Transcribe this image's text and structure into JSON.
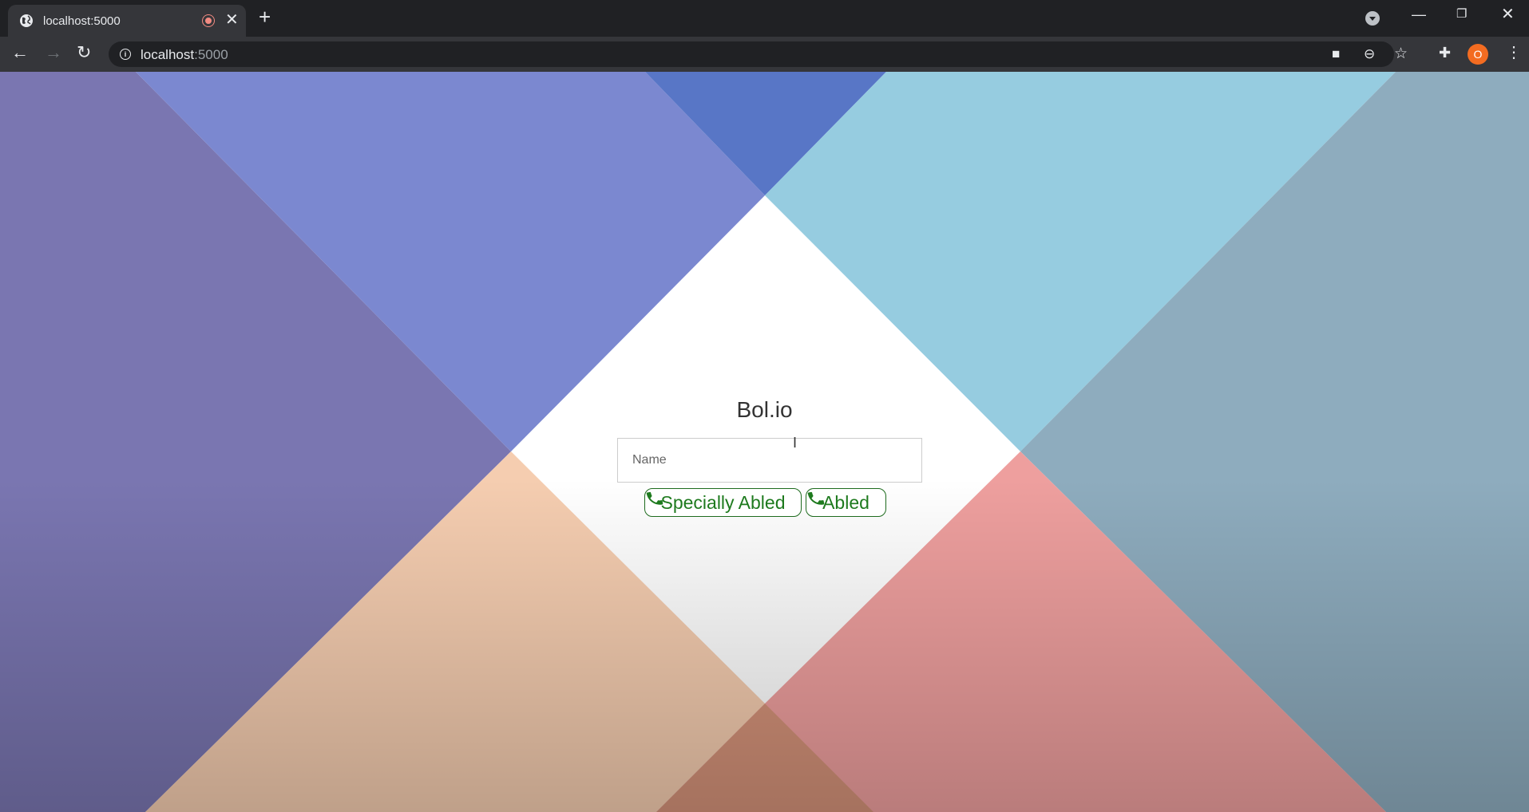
{
  "browser": {
    "tab_title": "localhost:5000",
    "url_host": "localhost",
    "url_port": ":5000",
    "profile_initial": "O",
    "icons": {
      "tab_favicon": "globe-icon",
      "recording": "recording-indicator-icon",
      "close": "close-icon",
      "new_tab": "plus-icon",
      "back": "back-arrow-icon",
      "forward": "forward-arrow-icon",
      "reload": "reload-icon",
      "site_info": "info-icon",
      "camera": "camera-icon",
      "zoom": "zoom-out-icon",
      "bookmark": "star-icon",
      "extensions": "puzzle-icon",
      "menu": "kebab-menu-icon"
    }
  },
  "page": {
    "title": "Bol.io",
    "name_placeholder": "Name",
    "buttons": {
      "specially_abled": "Specially Abled",
      "abled": "Abled"
    },
    "colors": {
      "button_text": "#1e7a1e",
      "bg_left": "#7a76b1",
      "bg_top_left": "#7b88d0",
      "bg_top_center": "#5876c6",
      "bg_top_right": "#96cce0",
      "bg_right": "#8eacbe",
      "bg_bottom_left": "#f5cdb0",
      "bg_bottom_right": "#ee9f9e"
    }
  }
}
